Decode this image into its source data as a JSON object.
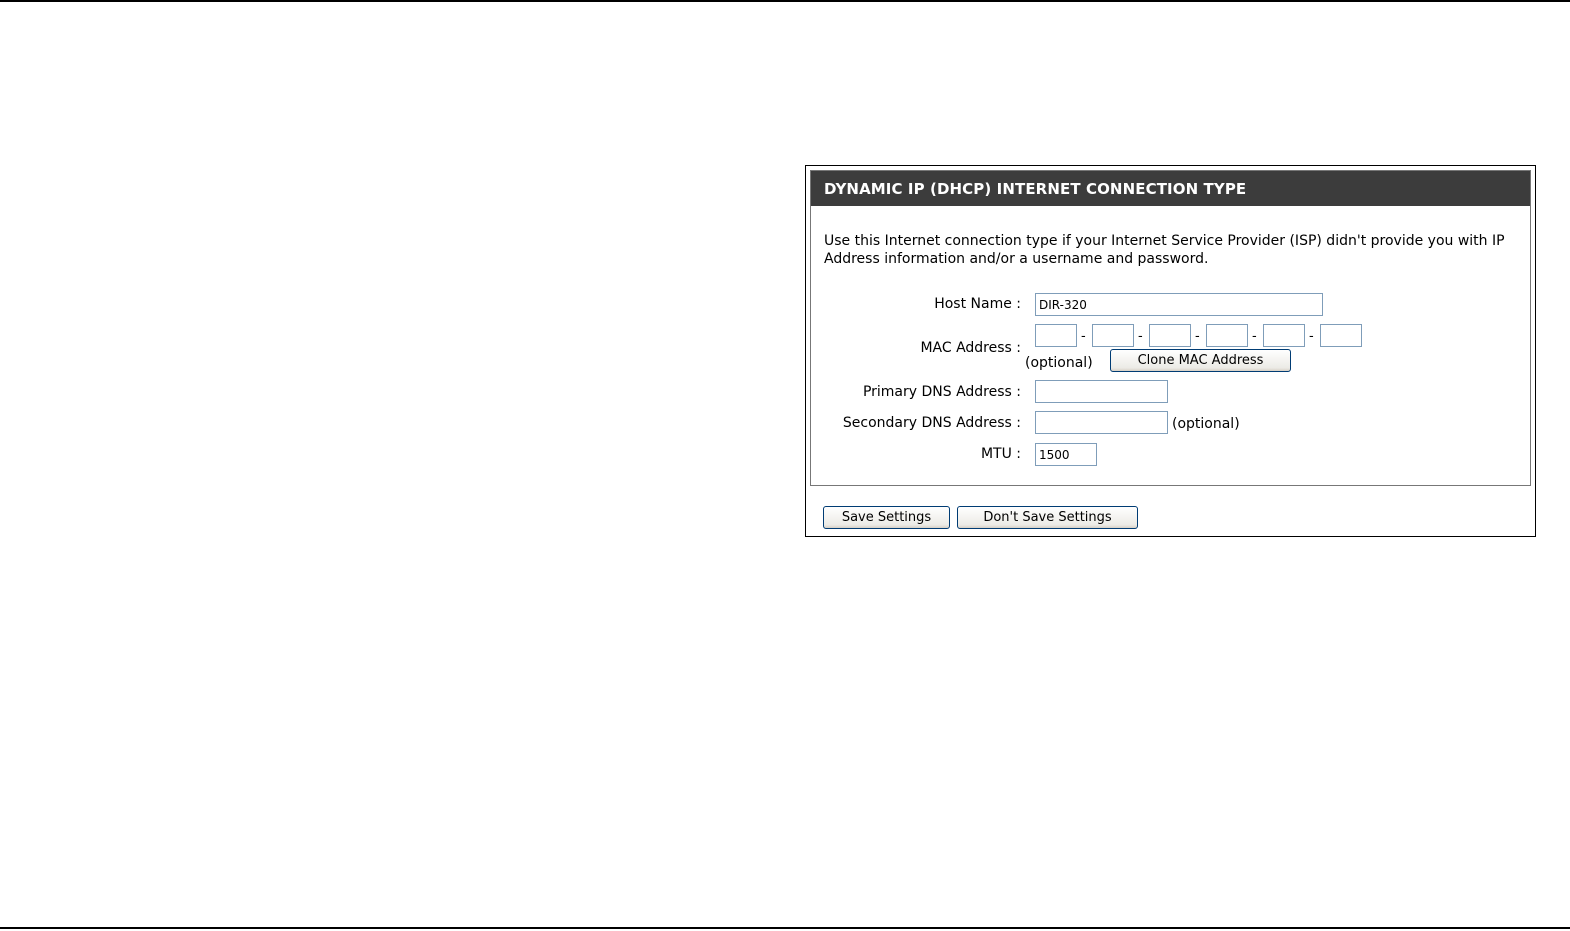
{
  "section": {
    "title": "DYNAMIC IP (DHCP) INTERNET CONNECTION TYPE",
    "description": "Use this Internet connection type if your Internet Service Provider (ISP) didn't provide you with IP Address information and/or a username and password."
  },
  "form": {
    "host_name": {
      "label": "Host Name :",
      "value": "DIR-320"
    },
    "mac_address": {
      "label": "MAC Address :",
      "octets": [
        "",
        "",
        "",
        "",
        "",
        ""
      ],
      "separator": "-",
      "optional_note": "(optional)",
      "clone_button": "Clone MAC Address"
    },
    "primary_dns": {
      "label": "Primary DNS Address :",
      "value": ""
    },
    "secondary_dns": {
      "label": "Secondary DNS Address :",
      "value": "",
      "optional_note": "(optional)"
    },
    "mtu": {
      "label": "MTU :",
      "value": "1500"
    }
  },
  "buttons": {
    "save": "Save Settings",
    "dont_save": "Don't Save Settings"
  }
}
